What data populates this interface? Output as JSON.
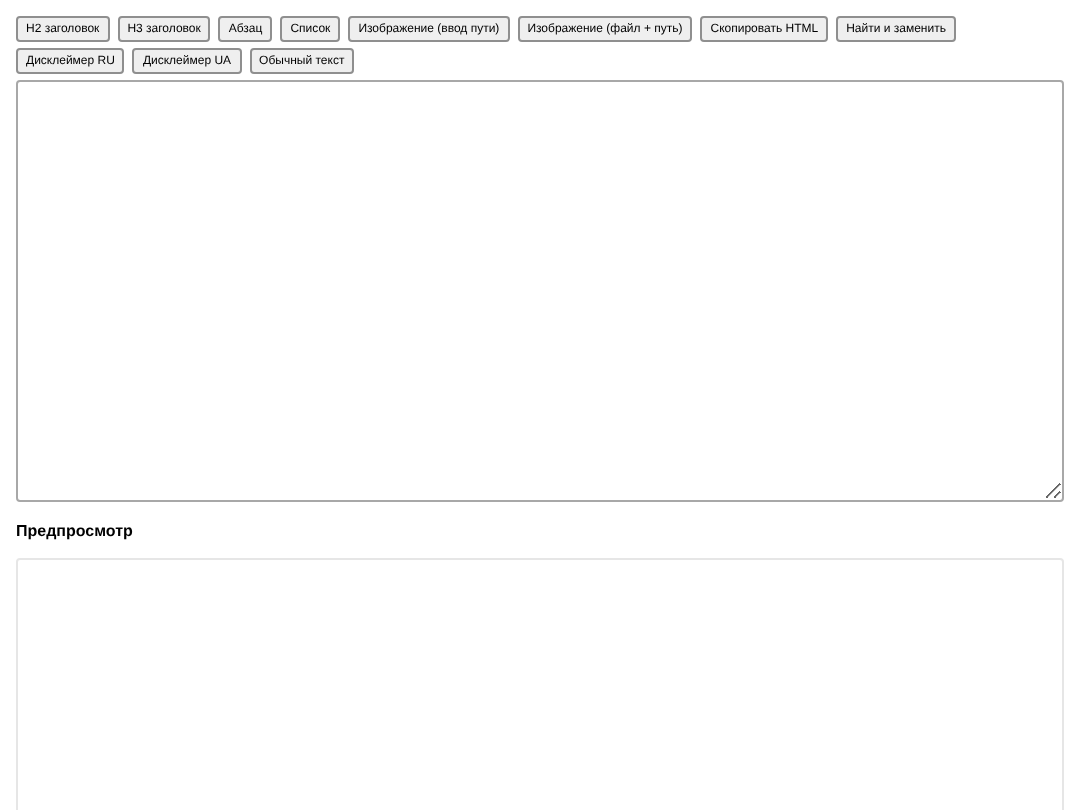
{
  "toolbar": {
    "buttons": [
      "H2 заголовок",
      "H3 заголовок",
      "Абзац",
      "Список",
      "Изображение (ввод пути)",
      "Изображение (файл + путь)",
      "Скопировать HTML",
      "Найти и заменить",
      "Дисклеймер RU",
      "Дисклеймер UA",
      "Обычный текст"
    ]
  },
  "preview": {
    "heading": "Предпросмотр"
  }
}
